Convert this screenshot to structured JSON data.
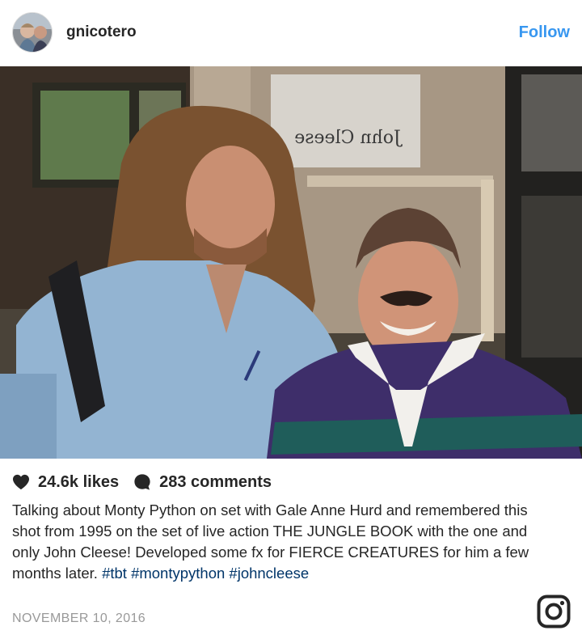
{
  "header": {
    "username": "gnicotero",
    "follow_label": "Follow"
  },
  "photo": {
    "sign_text": "John Cleese"
  },
  "stats": {
    "likes": "24.6k likes",
    "comments": "283 comments",
    "heart_icon": "heart-icon",
    "comment_icon": "comment-bubble-icon"
  },
  "caption": {
    "text": "Talking about Monty Python on set with Gale Anne Hurd and remembered this shot from 1995 on the set of live action THE JUNGLE BOOK with the one and only John Cleese! Developed some fx for FIERCE CREATURES for him a few months later. ",
    "hashtags": [
      "#tbt",
      "#montypython",
      "#johncleese"
    ]
  },
  "date": "NOVEMBER 10, 2016",
  "colors": {
    "follow": "#3897f0",
    "hashtag": "#003569",
    "date": "#999999"
  }
}
